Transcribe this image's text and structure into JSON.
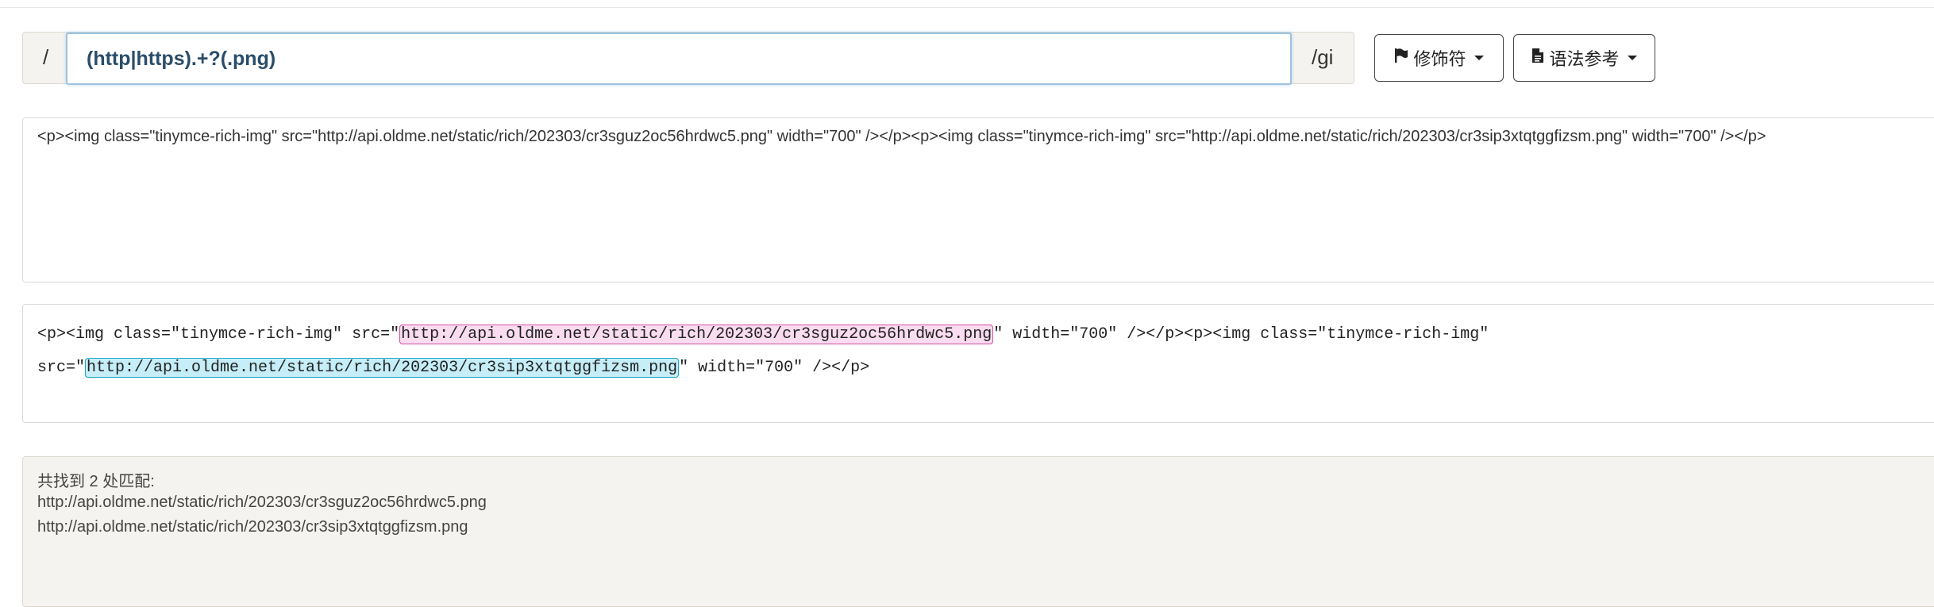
{
  "regex": {
    "delimiter_left": "/",
    "pattern": "(http|https).+?(.png)",
    "flags": "/gi"
  },
  "toolbar": {
    "modifiers_label": "修饰符",
    "modifiers_icon": "flag-icon",
    "reference_label": "语法参考",
    "reference_icon": "document-icon"
  },
  "source": {
    "text": "<p><img class=\"tinymce-rich-img\" src=\"http://api.oldme.net/static/rich/202303/cr3sguz2oc56hrdwc5.png\" width=\"700\" /></p><p><img class=\"tinymce-rich-img\" src=\"http://api.oldme.net/static/rich/202303/cr3sip3xtqtggfizsm.png\" width=\"700\" /></p>"
  },
  "highlight": {
    "line1_before": "<p><img class=\"tinymce-rich-img\" src=\"",
    "match1": "http://api.oldme.net/static/rich/202303/cr3sguz2oc56hrdwc5.png",
    "line1_after": "\" width=\"700\" /></p><p><img class=\"tinymce-rich-img\"",
    "line2_before": "src=\"",
    "match2": "http://api.oldme.net/static/rich/202303/cr3sip3xtqtggfizsm.png",
    "line2_after": "\" width=\"700\" /></p>",
    "match_colors": [
      "#f9dcef",
      "#c6eef8"
    ]
  },
  "result": {
    "summary": "共找到 2 处匹配:",
    "matches": [
      "http://api.oldme.net/static/rich/202303/cr3sguz2oc56hrdwc5.png",
      "http://api.oldme.net/static/rich/202303/cr3sip3xtqtggfizsm.png"
    ]
  }
}
